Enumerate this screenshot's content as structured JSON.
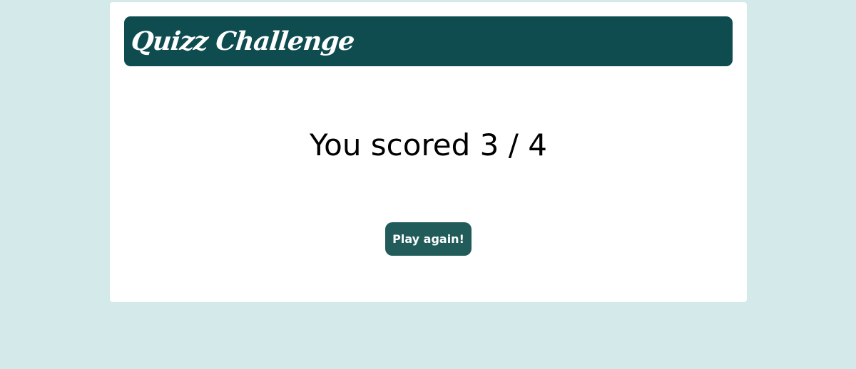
{
  "header": {
    "title": "Quizz Challenge"
  },
  "result": {
    "text": "You scored 3 / 4"
  },
  "actions": {
    "play_again_label": "Play again!"
  },
  "colors": {
    "page_background": "#d4eaea",
    "card_background": "#ffffff",
    "header_background": "#0e4c50",
    "button_background": "#215c5a",
    "button_text": "#ffffff"
  }
}
